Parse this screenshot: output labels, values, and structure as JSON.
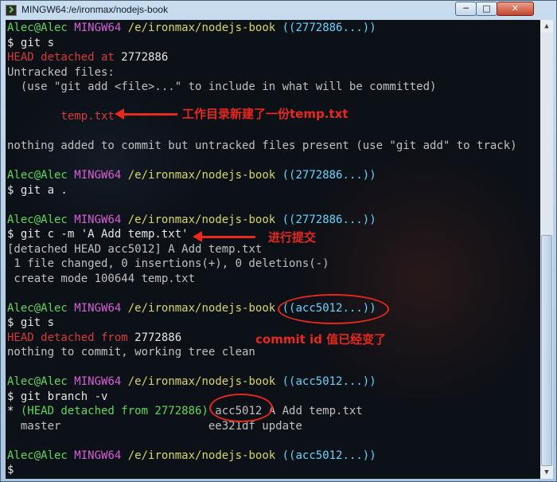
{
  "window": {
    "title": "MINGW64:/e/ironmax/nodejs-book",
    "controls": {
      "minimize": "─",
      "maximize": "□",
      "close": "✕"
    }
  },
  "terminal": {
    "prompt_user": "Alec@Alec",
    "prompt_sys": "MINGW64",
    "prompt_path": "/e/ironmax/nodejs-book",
    "lines": [
      {
        "kind": "prompt",
        "branch": "((2772886...))"
      },
      {
        "kind": "cmd",
        "text": "$ git s"
      },
      {
        "kind": "mixed",
        "red": "HEAD detached at",
        "rest": " 2772886"
      },
      {
        "kind": "text",
        "text": "Untracked files:"
      },
      {
        "kind": "text",
        "text": "  (use \"git add <file>...\" to include in what will be committed)"
      },
      {
        "kind": "blank"
      },
      {
        "kind": "red",
        "text": "        temp.txt"
      },
      {
        "kind": "blank"
      },
      {
        "kind": "text",
        "text": "nothing added to commit but untracked files present (use \"git add\" to track)"
      },
      {
        "kind": "blank"
      },
      {
        "kind": "prompt",
        "branch": "((2772886...))"
      },
      {
        "kind": "cmd",
        "text": "$ git a ."
      },
      {
        "kind": "blank"
      },
      {
        "kind": "prompt",
        "branch": "((2772886...))"
      },
      {
        "kind": "cmd",
        "text": "$ git c -m 'A Add temp.txt'"
      },
      {
        "kind": "text",
        "text": "[detached HEAD acc5012] A Add temp.txt"
      },
      {
        "kind": "text",
        "text": " 1 file changed, 0 insertions(+), 0 deletions(-)"
      },
      {
        "kind": "text",
        "text": " create mode 100644 temp.txt"
      },
      {
        "kind": "blank"
      },
      {
        "kind": "prompt",
        "branch": "((acc5012...))"
      },
      {
        "kind": "cmd",
        "text": "$ git s"
      },
      {
        "kind": "mixed",
        "red": "HEAD detached from",
        "rest": " 2772886"
      },
      {
        "kind": "text",
        "text": "nothing to commit, working tree clean"
      },
      {
        "kind": "blank"
      },
      {
        "kind": "prompt",
        "branch": "((acc5012...))"
      },
      {
        "kind": "cmd",
        "text": "$ git branch -v"
      },
      {
        "kind": "branchline",
        "star": "* ",
        "green": "(HEAD detached from 2772886)",
        "rest": " acc5012 A Add temp.txt"
      },
      {
        "kind": "text",
        "text": "  master                      ee321df update"
      },
      {
        "kind": "blank"
      },
      {
        "kind": "prompt",
        "branch": "((acc5012...))"
      },
      {
        "kind": "cmd",
        "text": "$ "
      }
    ]
  },
  "annotations": {
    "new_file": "工作目录新建了一份temp.txt",
    "commit": "进行提交",
    "commit_id_changed": "commit id 值已经变了"
  },
  "colors": {
    "annotation": "#e8281c",
    "prompt_user": "#5fd75f",
    "prompt_sys": "#d75fd7",
    "prompt_path": "#d7d75f",
    "prompt_branch": "#5fd7ff",
    "error_red": "#d73a3a"
  }
}
